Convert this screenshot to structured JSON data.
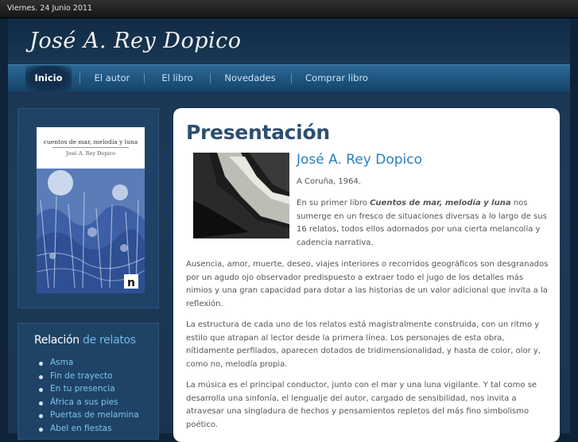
{
  "topbar": {
    "date": "Viernes. 24 Junio 2011"
  },
  "header": {
    "site_title": "José A. Rey Dopico"
  },
  "nav": {
    "items": [
      {
        "label": "Inicio",
        "active": true
      },
      {
        "label": "El autor",
        "active": false
      },
      {
        "label": "El libro",
        "active": false
      },
      {
        "label": "Novedades",
        "active": false
      },
      {
        "label": "Comprar libro",
        "active": false
      }
    ]
  },
  "sidebar": {
    "cover": {
      "title": "cuentos de mar, melodía y luna",
      "author": "José A. Rey Dopico",
      "logo": "n"
    }
  },
  "relatos": {
    "heading_white": "Relación",
    "heading_blue": " de relatos",
    "items": [
      "Asma",
      "Fin de trayecto",
      "En tu presencia",
      "África a sus pies",
      "Puertas de melamina",
      "Abel en fiestas"
    ]
  },
  "content": {
    "title": "Presentación",
    "author_name": "José A. Rey Dopico",
    "origin": "A Coruña, 1964.",
    "intro_before": "En su primer libro ",
    "intro_book": "Cuentos de mar, melodía y luna",
    "intro_after": " nos sumerge en un fresco de situaciones diversas a lo largo de sus 16 relatos, todos ellos adornados por una cierta melancolía y cadencia narrativa.",
    "paragraphs": [
      "Ausencia, amor, muerte, deseo, viajes interiores o recorridos geográficos son desgranados por un agudo ojo observador predispuesto a extraer todo el jugo de los detalles más nimios y una gran capacidad para dotar a las historias de un valor adicional que invita a la reflexión.",
      "La estructura de cada uno de los relatos está magistralmente construida, con un ritmo y estilo que atrapan al lector desde la primera línea. Los personajes de esta obra, nítidamente perfilados, aparecen dotados de tridimensionalidad, y hasta de color, olor y, como no, melodía propia.",
      "La música es el principal conductor, junto con el mar y una luna vigilante. Y tal como se desarrolla una sinfonía, el lengualje del autor, cargado de sensibilidad, nos invita a atravesar una singladura de hechos y pensamientos repletos del más fino simbolismo poético."
    ]
  }
}
